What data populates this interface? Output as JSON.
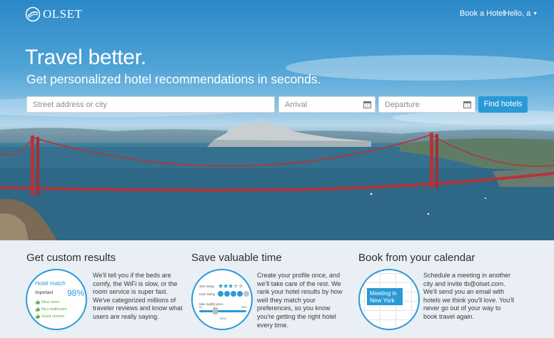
{
  "app": {
    "name": "OLSET"
  },
  "nav": {
    "book_label": "Book a Hotel",
    "user_label": "Hello, a"
  },
  "hero": {
    "headline": "Travel better.",
    "subline": "Get personalized hotel recommendations in seconds."
  },
  "search": {
    "street_placeholder": "Street address or city",
    "arrival_placeholder": "Arrival",
    "departure_placeholder": "Departure",
    "find_label": "Find hotels"
  },
  "features": [
    {
      "title": "Get custom results",
      "text": "We'll tell you if the beds are comfy, the WiFi is slow, or the room service is super fast. We've categorized millions of traveler reviews and know what users are really saying."
    },
    {
      "title": "Save valuable time",
      "text": "Create your profile once, and we'll take care of the rest. We rank your hotel results by how well they match your preferences, so you know you're getting the right hotel every time."
    },
    {
      "title": "Book from your calendar",
      "text": "Schedule a meeting in another city and invite tb@olset.com. We'll send you an email with hotels we think you'll love. You'll never go out of your way to book travel again."
    }
  ],
  "hotel_match": {
    "title": "Hotel match",
    "important": "Important",
    "percent": "98%",
    "items": [
      "Nice room",
      "Nice bathroom",
      "Good service"
    ]
  },
  "preferences": {
    "star_label": "Star rating",
    "star_value": 3,
    "star_max": 5,
    "user_label": "User rating",
    "user_value": 4,
    "user_max": 5,
    "price_label": "Max nightly price",
    "price_min": "$0",
    "price_max": "$600",
    "price_value": "$350"
  },
  "calendar": {
    "event": "Meeting in New York"
  },
  "colors": {
    "accent": "#2a9ad6",
    "positive": "#5ba84a"
  }
}
